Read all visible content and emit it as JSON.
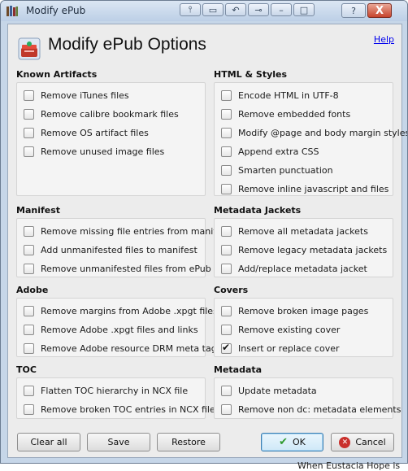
{
  "window": {
    "title": "Modify ePub",
    "help_label": "?",
    "close_label": "X"
  },
  "dialog": {
    "title": "Modify ePub Options",
    "help_link": "Help"
  },
  "sections": {
    "known_artifacts": {
      "title": "Known Artifacts",
      "options": [
        {
          "label": "Remove iTunes files",
          "checked": false
        },
        {
          "label": "Remove calibre bookmark files",
          "checked": false
        },
        {
          "label": "Remove OS artifact files",
          "checked": false
        },
        {
          "label": "Remove unused image files",
          "checked": false
        }
      ]
    },
    "html_styles": {
      "title": "HTML & Styles",
      "options": [
        {
          "label": "Encode HTML in UTF-8",
          "checked": false
        },
        {
          "label": "Remove embedded fonts",
          "checked": false
        },
        {
          "label": "Modify @page and body margin styles",
          "checked": false
        },
        {
          "label": "Append extra CSS",
          "checked": false
        },
        {
          "label": "Smarten punctuation",
          "checked": false
        },
        {
          "label": "Remove inline javascript and files",
          "checked": false
        }
      ]
    },
    "manifest": {
      "title": "Manifest",
      "options": [
        {
          "label": "Remove missing file entries from manifest",
          "checked": false
        },
        {
          "label": "Add unmanifested files to manifest",
          "checked": false
        },
        {
          "label": "Remove unmanifested files from ePub",
          "checked": false
        }
      ]
    },
    "metadata_jackets": {
      "title": "Metadata Jackets",
      "options": [
        {
          "label": "Remove all metadata jackets",
          "checked": false
        },
        {
          "label": "Remove legacy metadata jackets",
          "checked": false
        },
        {
          "label": "Add/replace metadata jacket",
          "checked": false
        }
      ]
    },
    "adobe": {
      "title": "Adobe",
      "options": [
        {
          "label": "Remove margins from Adobe .xpgt files",
          "checked": false
        },
        {
          "label": "Remove Adobe .xpgt files and links",
          "checked": false
        },
        {
          "label": "Remove Adobe resource DRM meta tags",
          "checked": false
        }
      ]
    },
    "covers": {
      "title": "Covers",
      "options": [
        {
          "label": "Remove broken image pages",
          "checked": false
        },
        {
          "label": "Remove existing cover",
          "checked": false
        },
        {
          "label": "Insert or replace cover",
          "checked": true
        }
      ]
    },
    "toc": {
      "title": "TOC",
      "options": [
        {
          "label": "Flatten TOC hierarchy in NCX file",
          "checked": false
        },
        {
          "label": "Remove broken TOC entries in NCX file",
          "checked": false
        }
      ]
    },
    "metadata": {
      "title": "Metadata",
      "options": [
        {
          "label": "Update metadata",
          "checked": false
        },
        {
          "label": "Remove non dc: metadata elements",
          "checked": false
        }
      ]
    }
  },
  "buttons": {
    "clear_all": "Clear all",
    "save": "Save",
    "restore": "Restore",
    "ok": "OK",
    "cancel": "Cancel"
  },
  "background_text": "When Eustacia Hope is"
}
